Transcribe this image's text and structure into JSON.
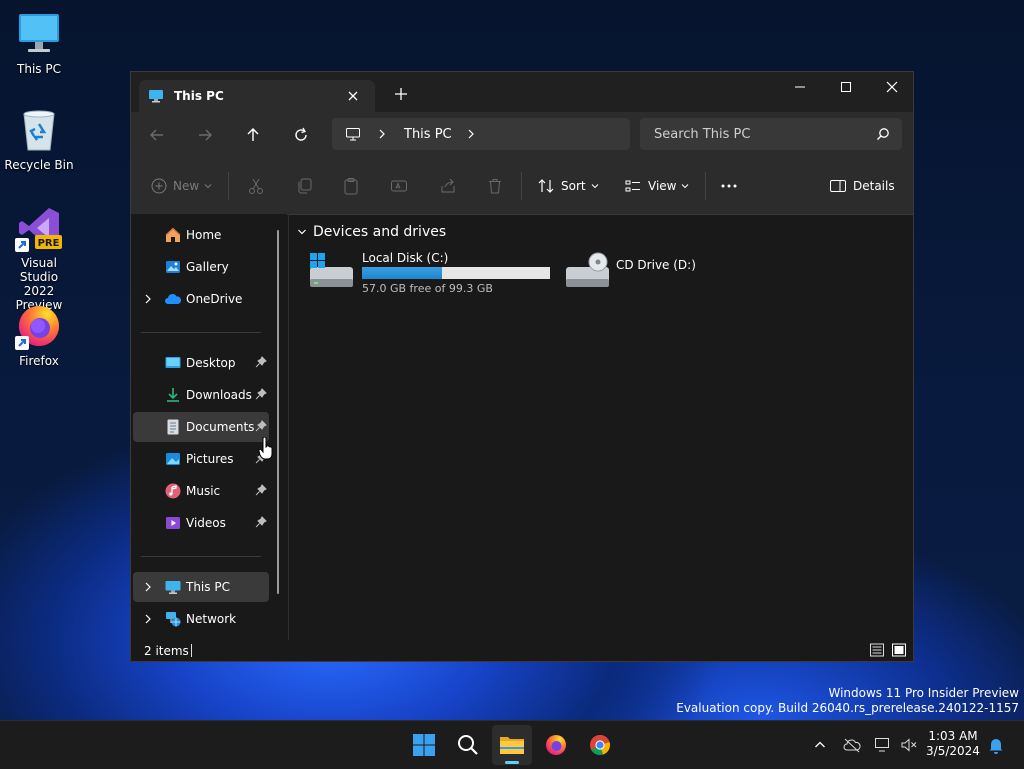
{
  "desktop": {
    "icons": [
      {
        "label": "This PC"
      },
      {
        "label": "Recycle Bin"
      },
      {
        "label": "Visual Studio\n2022 Preview",
        "line1": "Visual Studio",
        "line2": "2022 Preview",
        "badge": "PRE"
      },
      {
        "label": "Firefox"
      }
    ],
    "watermark_line1": "Windows 11 Pro Insider Preview",
    "watermark_line2": "Evaluation copy. Build 26040.rs_prerelease.240122-1157"
  },
  "explorer": {
    "tab_title": "This PC",
    "address": {
      "segment": "This PC"
    },
    "search": {
      "placeholder": "Search This PC"
    },
    "toolbar": {
      "new": "New",
      "sort": "Sort",
      "view": "View",
      "details": "Details"
    },
    "sidebar": {
      "items": [
        {
          "label": "Home",
          "icon": "home-icon"
        },
        {
          "label": "Gallery",
          "icon": "gallery-icon"
        },
        {
          "label": "OneDrive",
          "icon": "onedrive-icon"
        },
        {
          "label": "Desktop",
          "icon": "desktop-folder-icon"
        },
        {
          "label": "Downloads",
          "icon": "downloads-icon"
        },
        {
          "label": "Documents",
          "icon": "documents-icon"
        },
        {
          "label": "Pictures",
          "icon": "pictures-icon"
        },
        {
          "label": "Music",
          "icon": "music-icon"
        },
        {
          "label": "Videos",
          "icon": "videos-icon"
        },
        {
          "label": "This PC",
          "icon": "pc-icon"
        },
        {
          "label": "Network",
          "icon": "network-icon"
        }
      ]
    },
    "content": {
      "group": "Devices and drives",
      "drives": [
        {
          "name": "Local Disk (C:)",
          "free": "57.0 GB free of 99.3 GB",
          "used_fraction": 0.426
        },
        {
          "name": "CD Drive (D:)"
        }
      ]
    },
    "status": {
      "items": "2 items"
    }
  },
  "taskbar": {
    "clock_time": "1:03 AM",
    "clock_date": "3/5/2024"
  },
  "colors": {
    "accent": "#60cdff",
    "drive_bar": "#1f86cf"
  }
}
